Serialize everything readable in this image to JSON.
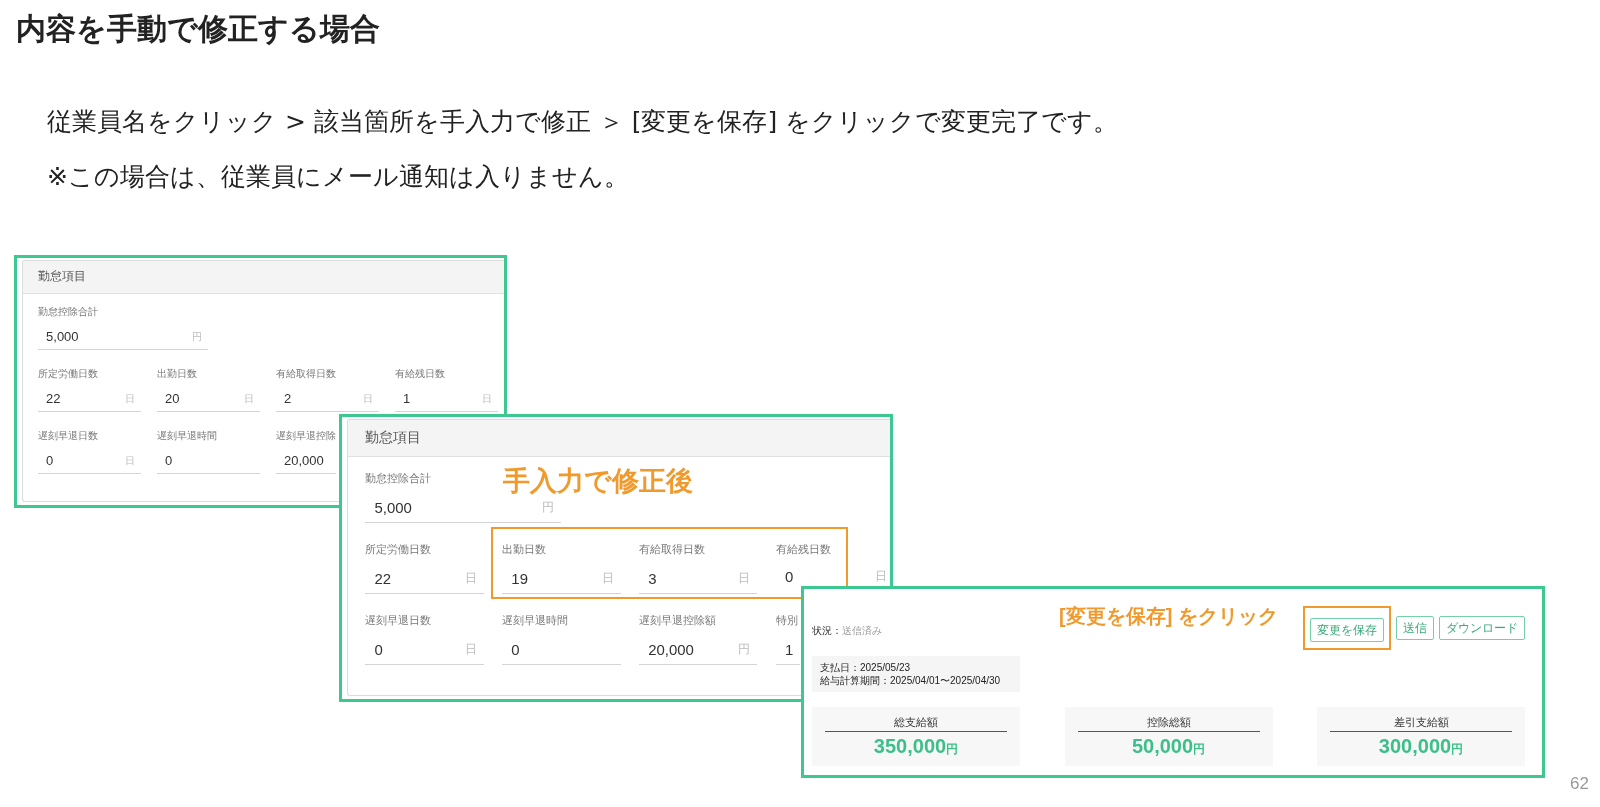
{
  "title": "内容を手動で修正する場合",
  "instructions": [
    "従業員名をクリック > 該当箇所を手入力で修正 ＞ [変更を保存] をクリックで変更完了です。",
    "※この場合は、従業員にメール通知は入りません。"
  ],
  "screenshots": [
    {
      "kind": "attendance_form",
      "header": "勤怠項目",
      "total": {
        "label": "勤怠控除合計",
        "value": "5,000",
        "unit": "円"
      },
      "rows": [
        [
          {
            "label": "所定労働日数",
            "value": "22",
            "unit": "日"
          },
          {
            "label": "出勤日数",
            "value": "20",
            "unit": "日"
          },
          {
            "label": "有給取得日数",
            "value": "2",
            "unit": "日"
          },
          {
            "label": "有給残日数",
            "value": "1",
            "unit": "日"
          }
        ],
        [
          {
            "label": "遅刻早退日数",
            "value": "0",
            "unit": "日"
          },
          {
            "label": "遅刻早退時間",
            "value": "0"
          },
          {
            "label": "遅刻早退控除",
            "value": "20,000"
          }
        ]
      ]
    },
    {
      "kind": "attendance_form",
      "header": "勤怠項目",
      "callout": "手入力で修正後",
      "total": {
        "label": "勤怠控除合計",
        "value": "5,000",
        "unit": "円"
      },
      "rows": [
        [
          {
            "label": "所定労働日数",
            "value": "22",
            "unit": "日",
            "highlighted": false
          },
          {
            "label": "出勤日数",
            "value": "19",
            "unit": "日",
            "highlighted": true
          },
          {
            "label": "有給取得日数",
            "value": "3",
            "unit": "日",
            "highlighted": true
          },
          {
            "label": "有給残日数",
            "value": "0",
            "unit": "日",
            "highlighted": true
          }
        ],
        [
          {
            "label": "遅刻早退日数",
            "value": "0",
            "unit": "日",
            "highlighted": false
          },
          {
            "label": "遅刻早退時間",
            "value": "0",
            "highlighted": false
          },
          {
            "label": "遅刻早退控除額",
            "value": "20,000",
            "unit": "円",
            "highlighted": false
          },
          {
            "label": "特別",
            "value": "1",
            "highlighted": false
          }
        ]
      ]
    },
    {
      "kind": "payslip",
      "status": {
        "label": "状況：",
        "value": "送信済み"
      },
      "callout": "[変更を保存] をクリック",
      "buttons": [
        {
          "label": "変更を保存",
          "highlighted": true
        },
        {
          "label": "送信",
          "highlighted": false
        },
        {
          "label": "ダウンロード",
          "highlighted": false
        }
      ],
      "info": [
        "支払日：2025/05/23",
        "給与計算期間：2025/04/01〜2025/04/30"
      ],
      "totals": [
        {
          "label": "総支給額",
          "amount": "350,000",
          "unit": "円"
        },
        {
          "label": "控除総額",
          "amount": "50,000",
          "unit": "円"
        },
        {
          "label": "差引支給額",
          "amount": "300,000",
          "unit": "円"
        }
      ]
    }
  ],
  "page_number": "62"
}
